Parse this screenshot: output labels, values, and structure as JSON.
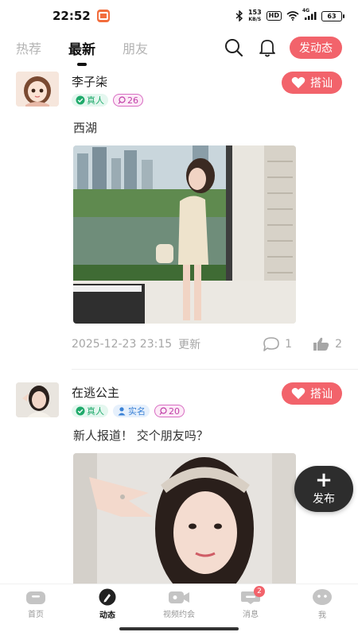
{
  "status_bar": {
    "time": "22:52",
    "net_speed_value": "153",
    "net_speed_unit": "KB/S",
    "hd": "HD",
    "signal_label": "4G",
    "battery": "63"
  },
  "top_nav": {
    "tabs": [
      {
        "label": "热荐",
        "active": false
      },
      {
        "label": "最新",
        "active": true
      },
      {
        "label": "朋友",
        "active": false
      }
    ],
    "post_button": "发动态"
  },
  "posts": [
    {
      "username": "李子柒",
      "tags": {
        "real": "真人",
        "level": "26"
      },
      "hello_button": "搭讪",
      "text": "西湖",
      "meta": {
        "time": "2025-12-23 23:15",
        "status": "更新",
        "comments": "1",
        "likes": "2"
      }
    },
    {
      "username": "在逃公主",
      "tags": {
        "real": "真人",
        "realname": "实名",
        "level": "20"
      },
      "hello_button": "搭讪",
      "text": "新人报道！ 交个朋友吗？"
    }
  ],
  "fab": {
    "label": "发布"
  },
  "bottom_nav": {
    "items": [
      {
        "label": "首页",
        "icon": "home-icon"
      },
      {
        "label": "动态",
        "icon": "feed-icon",
        "active": true
      },
      {
        "label": "视频约会",
        "icon": "video-icon"
      },
      {
        "label": "消息",
        "icon": "message-icon",
        "badge": "2"
      },
      {
        "label": "我",
        "icon": "profile-icon"
      }
    ]
  },
  "colors": {
    "accent": "#f2636b",
    "fab": "#2d2d2d",
    "real_tag": "#1faa6b",
    "name_tag": "#3b82d6",
    "level_tag": "#c040a8"
  }
}
